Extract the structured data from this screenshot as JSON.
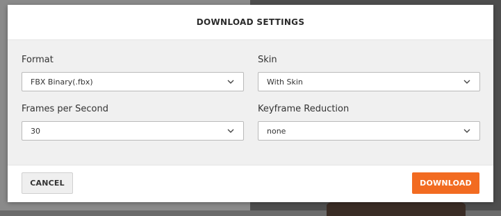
{
  "dialog": {
    "title": "DOWNLOAD SETTINGS"
  },
  "fields": {
    "format": {
      "label": "Format",
      "value": "FBX Binary(.fbx)"
    },
    "skin": {
      "label": "Skin",
      "value": "With Skin"
    },
    "fps": {
      "label": "Frames per Second",
      "value": "30"
    },
    "keyframe_reduction": {
      "label": "Keyframe Reduction",
      "value": "none"
    }
  },
  "footer": {
    "cancel_label": "CANCEL",
    "download_label": "DOWNLOAD"
  },
  "colors": {
    "accent": "#f26b21",
    "body_bg": "#f0f0f0"
  },
  "icons": {
    "select_chevron": "chevron-down-icon"
  }
}
